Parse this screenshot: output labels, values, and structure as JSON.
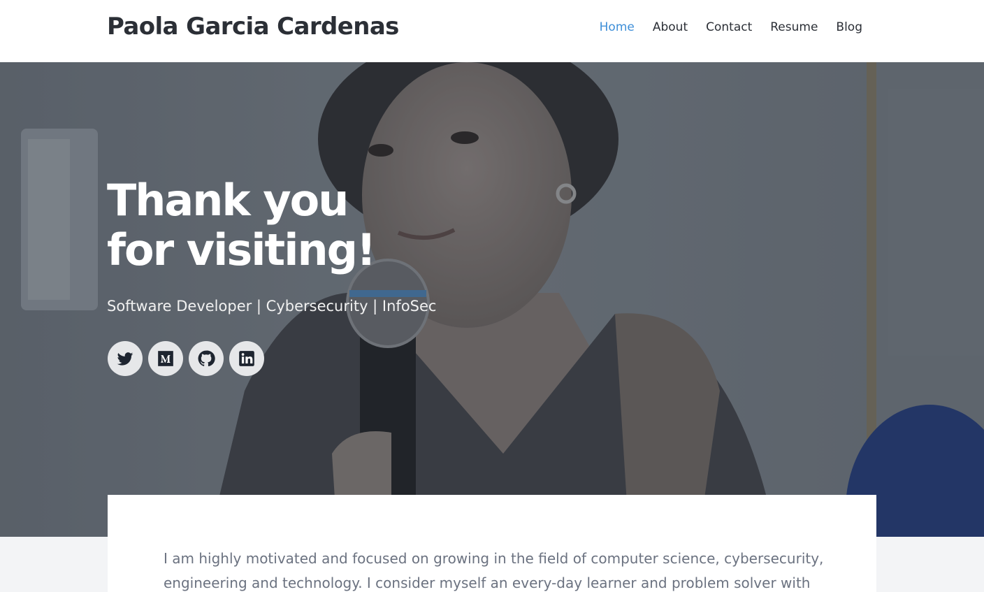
{
  "header": {
    "brand": "Paola Garcia Cardenas",
    "nav": [
      {
        "label": "Home",
        "active": true
      },
      {
        "label": "About",
        "active": false
      },
      {
        "label": "Contact",
        "active": false
      },
      {
        "label": "Resume",
        "active": false
      },
      {
        "label": "Blog",
        "active": false
      }
    ]
  },
  "hero": {
    "title_line1": "Thank you",
    "title_line2": "for visiting!",
    "subtitle": "Software Developer | Cybersecurity | InfoSec",
    "socials": [
      {
        "name": "twitter-icon"
      },
      {
        "name": "medium-icon"
      },
      {
        "name": "github-icon"
      },
      {
        "name": "linkedin-icon"
      }
    ]
  },
  "intro": {
    "text": "I am highly motivated and focused on growing in the field of computer science, cybersecurity, engineering and technology. I consider myself an every-day learner and problem solver with"
  },
  "colors": {
    "accent": "#3f8fd8",
    "text_dark": "#2b2f36",
    "text_muted": "#6b7280",
    "page_bg": "#f3f4f6"
  }
}
